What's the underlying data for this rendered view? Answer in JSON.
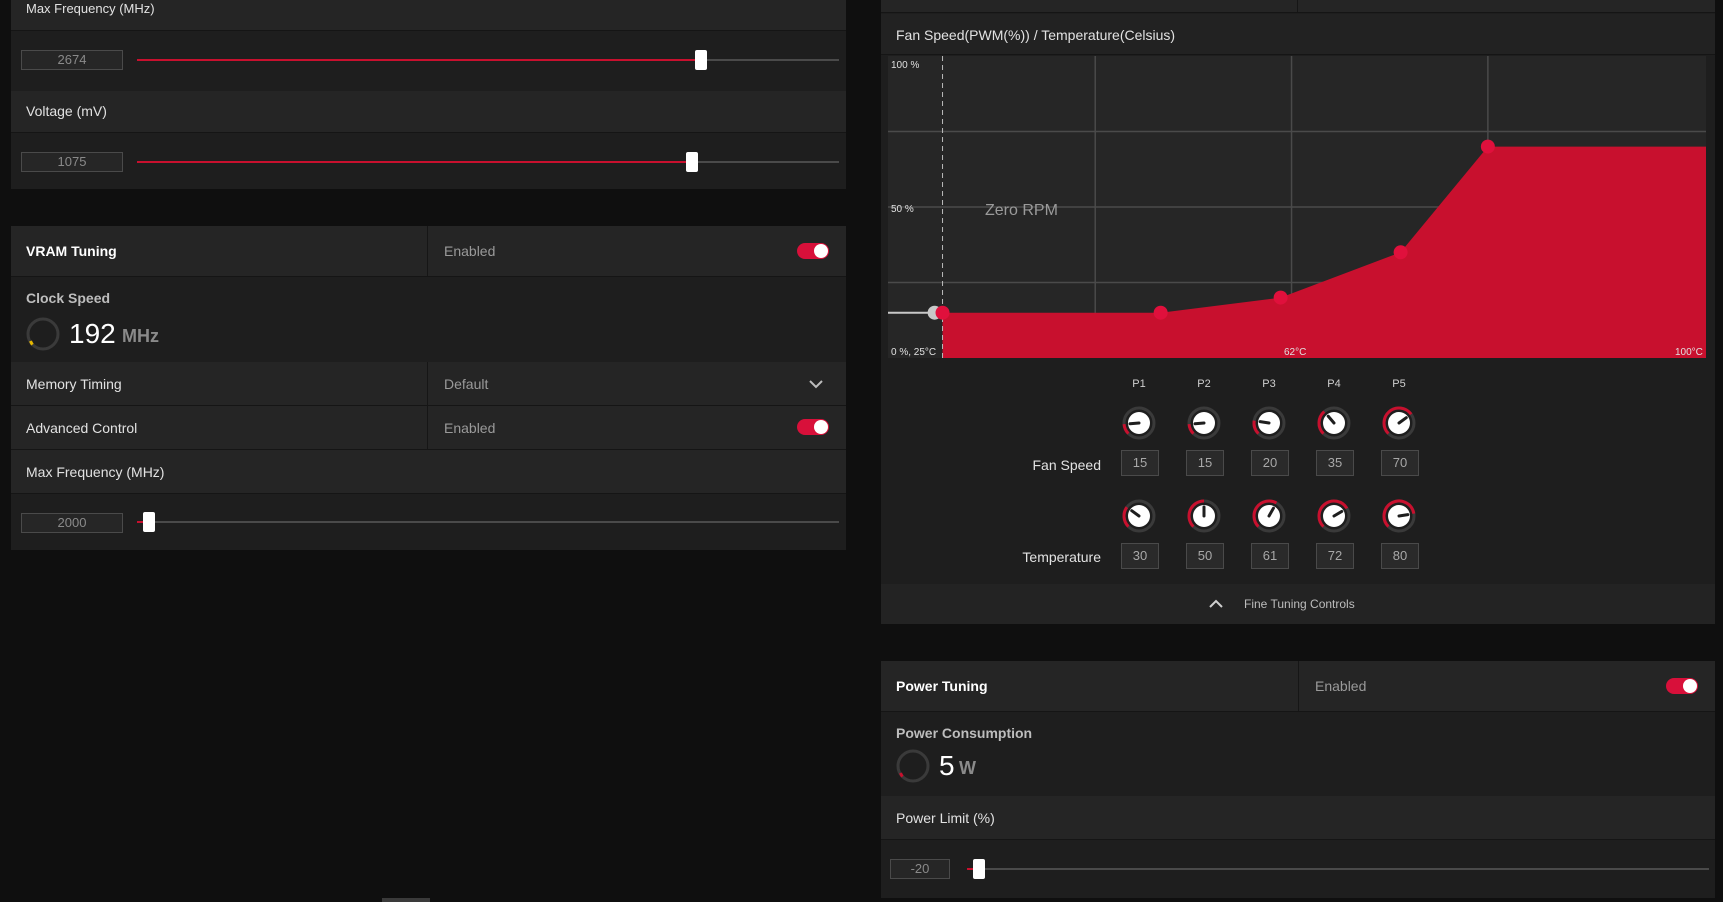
{
  "gpu": {
    "max_frequency_label": "Max Frequency (MHz)",
    "max_frequency_value": "2674",
    "max_frequency_level": 0.8,
    "voltage_label": "Voltage (mV)",
    "voltage_value": "1075",
    "voltage_level": 0.8
  },
  "vram": {
    "title": "VRAM Tuning",
    "status": "Enabled",
    "clock_label": "Clock Speed",
    "clock_value": "192",
    "clock_unit": "MHz",
    "memory_timing_label": "Memory Timing",
    "memory_timing_value": "Default",
    "advanced_control_label": "Advanced Control",
    "advanced_control_value": "Enabled",
    "max_frequency_label": "Max Frequency (MHz)",
    "max_frequency_value": "2000",
    "max_frequency_level": 0.0
  },
  "fan": {
    "title": "Fan Speed(PWM(%)) / Temperature(Celsius)",
    "zero_rpm_label": "Zero RPM",
    "fan_speed_row_label": "Fan Speed",
    "temperature_row_label": "Temperature",
    "points": [
      {
        "label": "P1",
        "speed": "15",
        "temp": "30"
      },
      {
        "label": "P2",
        "speed": "15",
        "temp": "50"
      },
      {
        "label": "P3",
        "speed": "20",
        "temp": "61"
      },
      {
        "label": "P4",
        "speed": "35",
        "temp": "72"
      },
      {
        "label": "P5",
        "speed": "70",
        "temp": "80"
      }
    ],
    "fine_tuning_label": "Fine Tuning Controls"
  },
  "chart_data": {
    "type": "area",
    "x": [
      30,
      50,
      61,
      72,
      80,
      100
    ],
    "y": [
      15,
      15,
      20,
      35,
      70,
      70
    ],
    "title": "Fan Speed(PWM(%)) / Temperature(Celsius)",
    "tick_labels": {
      "y_top": "100 %",
      "y_mid": "50 %",
      "origin": "0 %, 25°C",
      "x_mid": "62°C",
      "x_max": "100°C"
    },
    "annotation": "Zero RPM",
    "xlim": [
      25,
      100
    ],
    "ylim": [
      0,
      100
    ],
    "zero_rpm_handle": {
      "x": 10,
      "y": 15
    },
    "fill_color": "#c8102e",
    "grid": true
  },
  "power": {
    "title": "Power Tuning",
    "status": "Enabled",
    "consumption_label": "Power Consumption",
    "consumption_value": "5",
    "consumption_unit": "W",
    "limit_label": "Power Limit (%)",
    "limit_value": "-20",
    "limit_level": 0.0
  },
  "colors": {
    "accent": "#c8102e",
    "toggle_on": "#d8103a",
    "gauge_yellow": "#e6b800"
  }
}
